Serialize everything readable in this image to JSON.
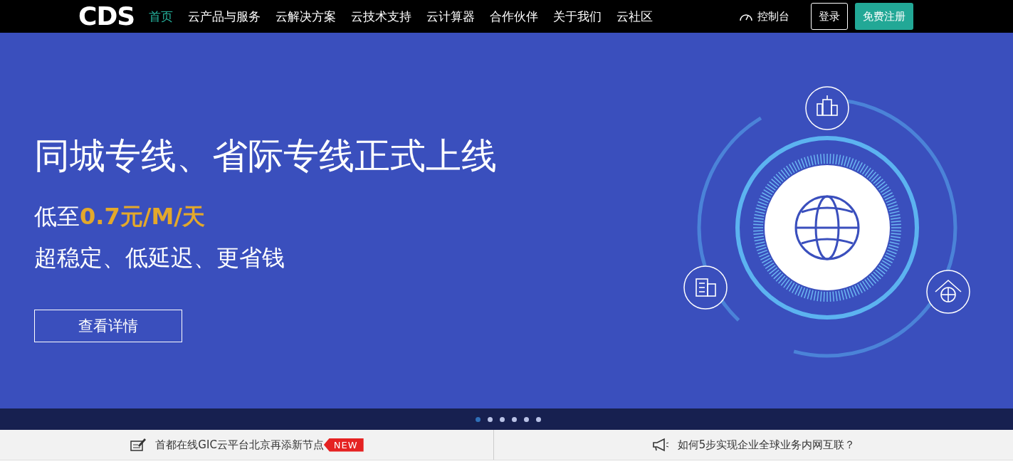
{
  "nav": {
    "logo": "CDS",
    "items": [
      {
        "label": "首页",
        "selected": true
      },
      {
        "label": "云产品与服务",
        "selected": false
      },
      {
        "label": "云解决方案",
        "selected": false
      },
      {
        "label": "云技术支持",
        "selected": false
      },
      {
        "label": "云计算器",
        "selected": false
      },
      {
        "label": "合作伙伴",
        "selected": false
      },
      {
        "label": "关于我们",
        "selected": false
      },
      {
        "label": "云社区",
        "selected": false
      }
    ],
    "console": "控制台",
    "login": "登录",
    "register": "免费注册"
  },
  "banner": {
    "headline": "同城专线、省际专线正式上线",
    "price": "低至**0.7元/M/天**",
    "tagline": "超稳定、低延迟、更省钱",
    "button": "查看详情"
  },
  "carousel": [
    {
      "selected": true
    },
    {
      "selected": false
    },
    {
      "selected": false
    },
    {
      "selected": false
    },
    {
      "selected": false
    },
    {
      "selected": false
    }
  ],
  "notices": [
    {
      "kind": "news",
      "text": "首都在线GIC云平台北京再添新节点",
      "tag": "NEW"
    },
    {
      "kind": "announcement",
      "text": "如何5步实现企业全球业务内网互联？"
    }
  ]
}
